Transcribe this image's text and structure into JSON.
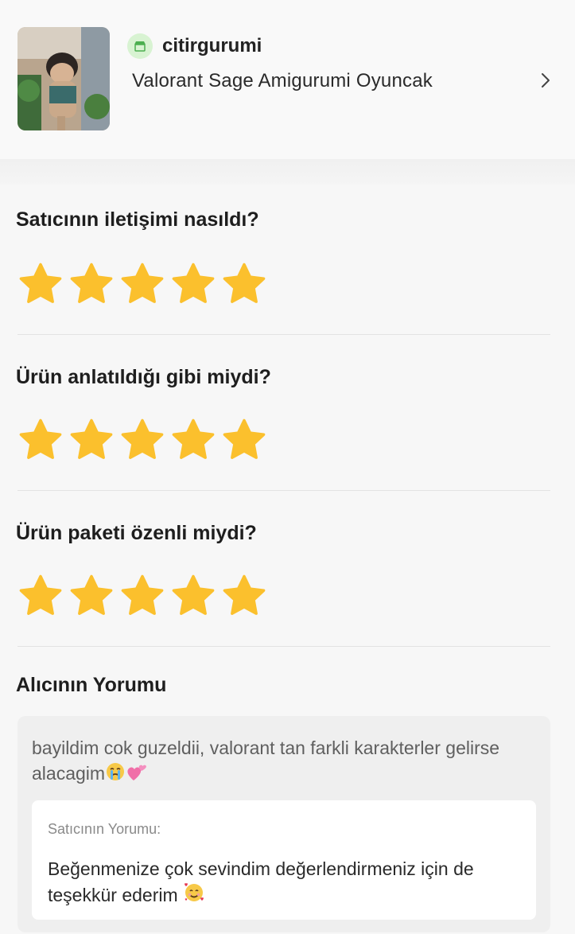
{
  "product": {
    "shop_name": "citirgurumi",
    "shop_icon": "shop-icon",
    "title": "Valorant Sage Amigurumi Oyuncak"
  },
  "colors": {
    "star": "#fbc02d",
    "shop_icon_bg": "#d8f3d2",
    "shop_icon_fg": "#4caf50"
  },
  "ratings": [
    {
      "question": "Satıcının iletişimi nasıldı?",
      "stars": 5,
      "max": 5
    },
    {
      "question": "Ürün anlatıldığı gibi miydi?",
      "stars": 5,
      "max": 5
    },
    {
      "question": "Ürün paketi özenli miydi?",
      "stars": 5,
      "max": 5
    }
  ],
  "buyer_comment": {
    "title": "Alıcının Yorumu",
    "text": "bayildim cok guzeldii, valorant tan farkli karakterler gelirse alacagim",
    "emojis": [
      "crying-face",
      "two-hearts"
    ]
  },
  "seller_comment": {
    "label": "Satıcının Yorumu:",
    "text": "Beğenmenize çok sevindim değerlendirmeniz için de teşekkür ederim",
    "emoji": "smiling-face-with-hearts"
  }
}
